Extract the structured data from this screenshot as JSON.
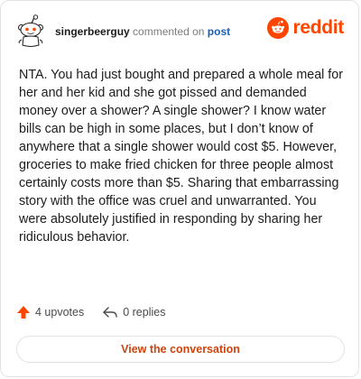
{
  "header": {
    "username": "singerbeerguy",
    "verb": "commented on",
    "post_link": "post"
  },
  "brand": {
    "wordmark": "reddit",
    "color": "#ff4500"
  },
  "comment": {
    "body": "NTA. You had just bought and prepared a whole meal for her and her kid and she got pissed and demanded money over a shower? A single shower? I know water bills can be high in some places, but I don’t know of anywhere that a single shower would cost $5. However, groceries to make fried chicken for three people almost certainly costs more than $5. Sharing that embarrassing story with the office was cruel and unwarranted. You were absolutely justified in responding by sharing her ridiculous behavior."
  },
  "actions": {
    "upvotes": "4 upvotes",
    "replies": "0 replies"
  },
  "cta": {
    "label": "View the conversation"
  },
  "icons": {
    "avatar": "snoo-avatar-icon",
    "brand": "reddit-logo-icon",
    "upvote": "upvote-arrow-icon",
    "reply": "reply-arrow-icon"
  }
}
